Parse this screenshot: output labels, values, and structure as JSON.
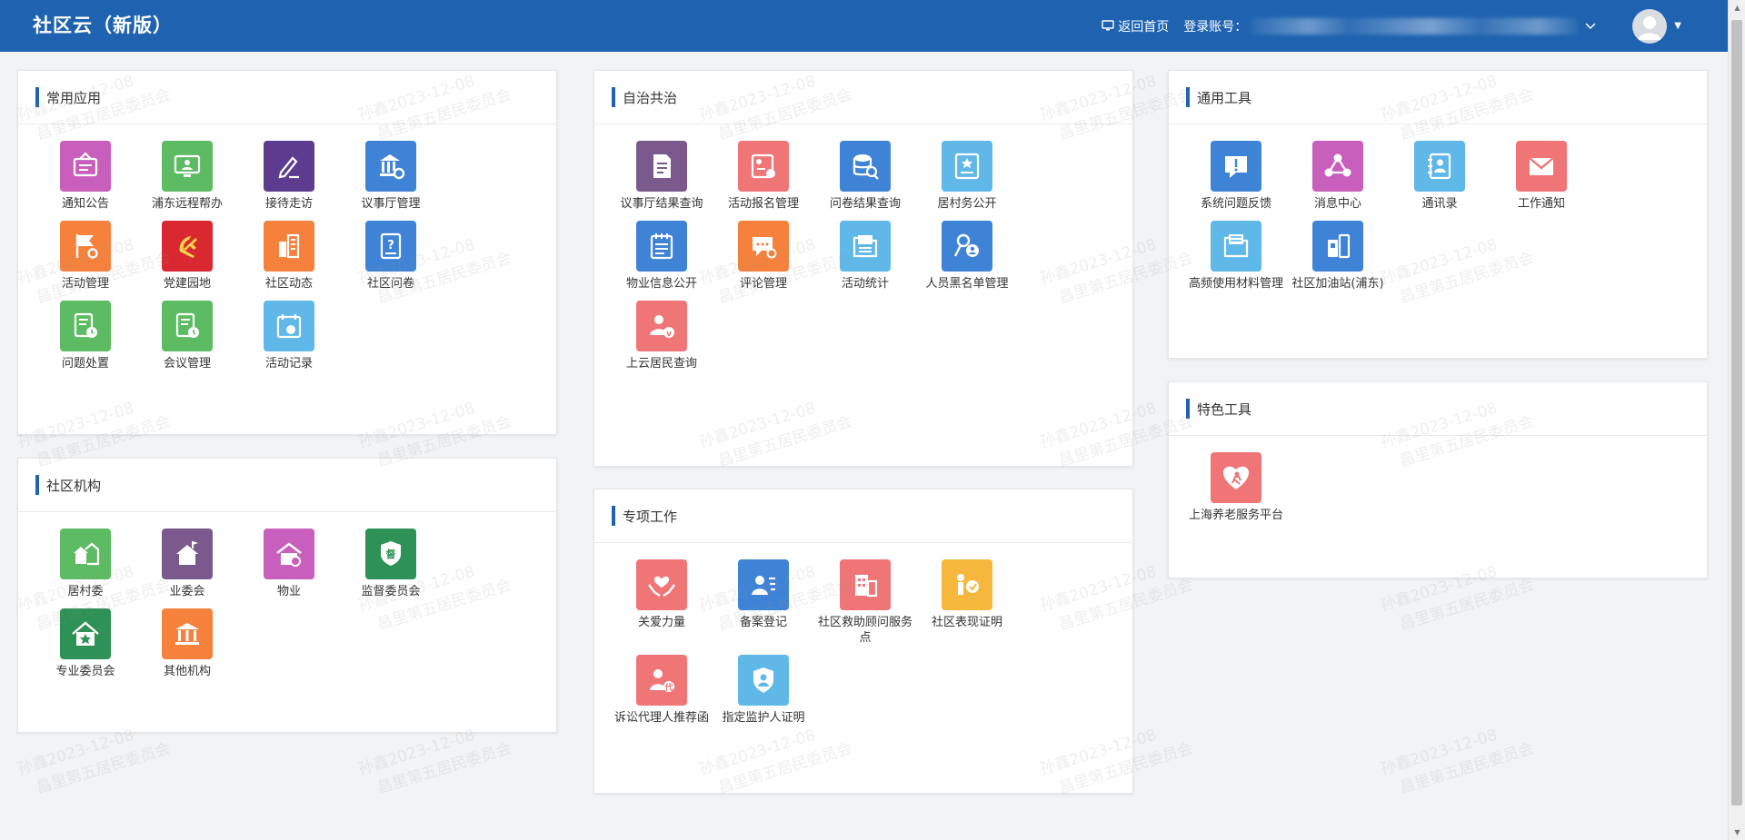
{
  "header": {
    "title": "社区云（新版）",
    "home_link": "返回首页",
    "account_label": "登录账号："
  },
  "watermark": {
    "line1": "孙鑫2023-12-08",
    "line2": "昌里第五居民委员会"
  },
  "colors": {
    "header_bg": "#1f63b0",
    "accent_bar": "#1f63b0",
    "page_bg": "#f2f3f5"
  },
  "panels": {
    "common": {
      "title": "常用应用",
      "items": [
        {
          "label": "通知公告",
          "icon": "notice-icon",
          "color": "#c95fbd"
        },
        {
          "label": "浦东远程帮办",
          "icon": "remote-desk-icon",
          "color": "#5dbb63"
        },
        {
          "label": "接待走访",
          "icon": "pen-edit-icon",
          "color": "#5d3b8f"
        },
        {
          "label": "议事厅管理",
          "icon": "hall-gear-icon",
          "color": "#3f83d6"
        },
        {
          "label": "活动管理",
          "icon": "flag-gear-icon",
          "color": "#f5813d"
        },
        {
          "label": "党建园地",
          "icon": "party-emblem-icon",
          "color": "#d9282f"
        },
        {
          "label": "社区动态",
          "icon": "buildings-icon",
          "color": "#f5813d"
        },
        {
          "label": "社区问卷",
          "icon": "questionnaire-icon",
          "color": "#3f83d6"
        },
        {
          "label": "问题处置",
          "icon": "doc-clock-icon",
          "color": "#5dbb63"
        },
        {
          "label": "会议管理",
          "icon": "meeting-doc-icon",
          "color": "#5dbb63"
        },
        {
          "label": "活动记录",
          "icon": "calendar-record-icon",
          "color": "#5fb8e8"
        }
      ]
    },
    "org": {
      "title": "社区机构",
      "items": [
        {
          "label": "居村委",
          "icon": "village-icon",
          "color": "#5dbb63"
        },
        {
          "label": "业委会",
          "icon": "house-flag-icon",
          "color": "#7a5a8c"
        },
        {
          "label": "物业",
          "icon": "property-house-icon",
          "color": "#c95fbd"
        },
        {
          "label": "监督委员会",
          "icon": "supervise-shield-icon",
          "color": "#2e9156"
        },
        {
          "label": "专业委员会",
          "icon": "house-star-icon",
          "color": "#2e9156"
        },
        {
          "label": "其他机构",
          "icon": "institution-icon",
          "color": "#f5813d"
        }
      ]
    },
    "autonomy": {
      "title": "自治共治",
      "items": [
        {
          "label": "议事厅结果查询",
          "icon": "doc-list-icon",
          "color": "#7a5a8c"
        },
        {
          "label": "活动报名管理",
          "icon": "signup-icon",
          "color": "#ef7577"
        },
        {
          "label": "问卷结果查询",
          "icon": "database-search-icon",
          "color": "#3f83d6"
        },
        {
          "label": "居村务公开",
          "icon": "bulletin-star-icon",
          "color": "#5fb8e8"
        },
        {
          "label": "物业信息公开",
          "icon": "property-notepad-icon",
          "color": "#3f83d6"
        },
        {
          "label": "评论管理",
          "icon": "comment-gear-icon",
          "color": "#f5813d"
        },
        {
          "label": "活动统计",
          "icon": "folder-stats-icon",
          "color": "#5fb8e8"
        },
        {
          "label": "人员黑名单管理",
          "icon": "key-person-icon",
          "color": "#3f83d6"
        },
        {
          "label": "上云居民查询",
          "icon": "person-verify-icon",
          "color": "#ef7577"
        }
      ]
    },
    "special_work": {
      "title": "专项工作",
      "items": [
        {
          "label": "关爱力量",
          "icon": "hands-heart-icon",
          "color": "#ef7577"
        },
        {
          "label": "备案登记",
          "icon": "person-card-icon",
          "color": "#3f83d6"
        },
        {
          "label": "社区救助顾问服务点",
          "icon": "service-building-icon",
          "color": "#ef7577"
        },
        {
          "label": "社区表现证明",
          "icon": "certificate-person-icon",
          "color": "#f5b83d"
        },
        {
          "label": "诉讼代理人推荐函",
          "icon": "agent-person-icon",
          "color": "#ef7577"
        },
        {
          "label": "指定监护人证明",
          "icon": "guardian-shield-icon",
          "color": "#5fb8e8"
        }
      ]
    },
    "tools": {
      "title": "通用工具",
      "items": [
        {
          "label": "系统问题反馈",
          "icon": "feedback-icon",
          "color": "#3f83d6"
        },
        {
          "label": "消息中心",
          "icon": "message-network-icon",
          "color": "#c95fbd"
        },
        {
          "label": "通讯录",
          "icon": "contacts-icon",
          "color": "#5fb8e8"
        },
        {
          "label": "工作通知",
          "icon": "mail-icon",
          "color": "#ef7577"
        },
        {
          "label": "高频使用材料管理",
          "icon": "files-icon",
          "color": "#5fb8e8"
        },
        {
          "label": "社区加油站(浦东)",
          "icon": "station-icon",
          "color": "#3f83d6"
        }
      ]
    },
    "featured": {
      "title": "特色工具",
      "items": [
        {
          "label": "上海养老服务平台",
          "icon": "elder-care-heart-icon",
          "color": "#ef7577"
        }
      ]
    }
  }
}
